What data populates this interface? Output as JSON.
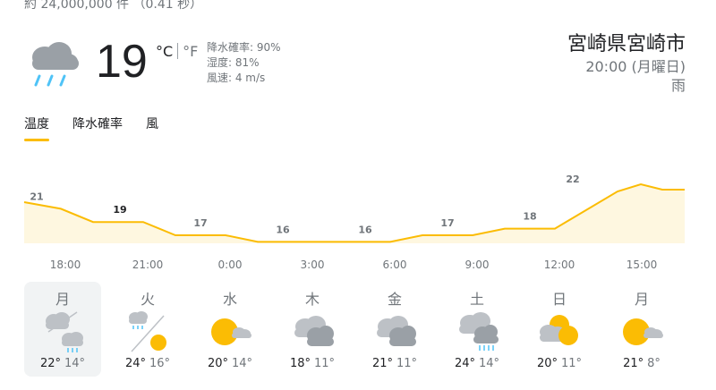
{
  "result_stats": "約 24,000,000 件 （0.41 秒）",
  "current": {
    "icon": "rain-icon",
    "temperature": "19",
    "unit_c": "°C",
    "unit_f": "°F",
    "precipitation": "降水確率: 90%",
    "humidity": "湿度: 81%",
    "wind": "風速: 4 m/s"
  },
  "location": {
    "name": "宮崎県宮崎市",
    "time": "20:00 (月曜日)",
    "condition": "雨"
  },
  "tabs": [
    {
      "label": "温度",
      "active": true
    },
    {
      "label": "降水確率",
      "active": false
    },
    {
      "label": "風",
      "active": false
    }
  ],
  "chart_data": {
    "type": "area",
    "x": [
      "18:00",
      "21:00",
      "0:00",
      "3:00",
      "6:00",
      "9:00",
      "12:00",
      "15:00"
    ],
    "values": [
      21,
      19,
      17,
      16,
      16,
      17,
      18,
      22
    ],
    "highlight_index": 1,
    "colors": {
      "line": "#fbbc04",
      "fill": "#fef7e0",
      "label": "#70757a",
      "highlight_label": "#202124"
    }
  },
  "days": [
    {
      "name": "月",
      "icon": "rain-icon",
      "high": "22°",
      "low": "14°",
      "selected": true
    },
    {
      "name": "火",
      "icon": "rain-then-sun-icon",
      "high": "24°",
      "low": "16°",
      "selected": false
    },
    {
      "name": "水",
      "icon": "sun-cloud-icon",
      "high": "20°",
      "low": "14°",
      "selected": false
    },
    {
      "name": "木",
      "icon": "cloudy-icon",
      "high": "18°",
      "low": "11°",
      "selected": false
    },
    {
      "name": "金",
      "icon": "cloudy-icon",
      "high": "21°",
      "low": "11°",
      "selected": false
    },
    {
      "name": "土",
      "icon": "cloud-rain-icon",
      "high": "24°",
      "low": "14°",
      "selected": false
    },
    {
      "name": "日",
      "icon": "cloud-sun-icon",
      "high": "20°",
      "low": "11°",
      "selected": false
    },
    {
      "name": "月",
      "icon": "sun-cloud-icon",
      "high": "21°",
      "low": "8°",
      "selected": false
    }
  ]
}
